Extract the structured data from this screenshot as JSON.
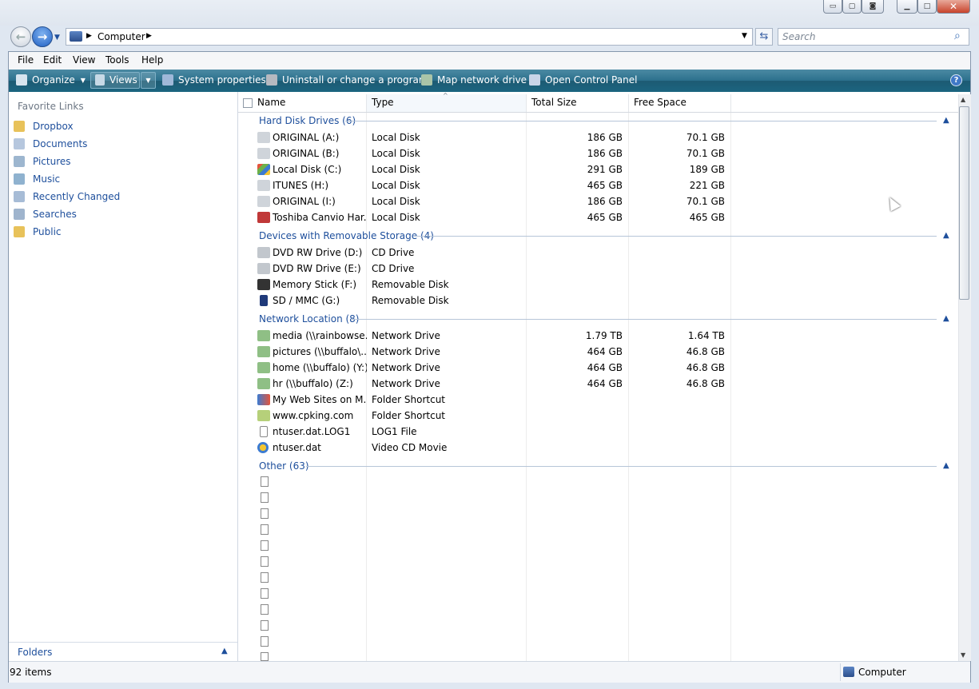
{
  "address": {
    "location": "Computer"
  },
  "search": {
    "placeholder": "Search"
  },
  "menu": {
    "items": [
      "File",
      "Edit",
      "View",
      "Tools",
      "Help"
    ]
  },
  "toolbar": {
    "organize": "Organize",
    "views": "Views",
    "system_properties": "System properties",
    "uninstall": "Uninstall or change a program",
    "map_drive": "Map network drive",
    "control_panel": "Open Control Panel"
  },
  "sidebar": {
    "header": "Favorite Links",
    "items": [
      {
        "label": "Dropbox",
        "icon": "folder-icon"
      },
      {
        "label": "Documents",
        "icon": "documents-icon"
      },
      {
        "label": "Pictures",
        "icon": "pictures-icon"
      },
      {
        "label": "Music",
        "icon": "music-icon"
      },
      {
        "label": "Recently Changed",
        "icon": "recent-icon"
      },
      {
        "label": "Searches",
        "icon": "search-folder-icon"
      },
      {
        "label": "Public",
        "icon": "folder-icon"
      }
    ],
    "folders_label": "Folders"
  },
  "columns": {
    "name": "Name",
    "type": "Type",
    "total": "Total Size",
    "free": "Free Space"
  },
  "groups": [
    {
      "title": "Hard Disk Drives (6)",
      "rows": [
        {
          "name": "ORIGINAL (A:)",
          "type": "Local Disk",
          "total": "186 GB",
          "free": "70.1 GB"
        },
        {
          "name": "ORIGINAL (B:)",
          "type": "Local Disk",
          "total": "186 GB",
          "free": "70.1 GB"
        },
        {
          "name": "Local Disk (C:)",
          "type": "Local Disk",
          "total": "291 GB",
          "free": "189 GB"
        },
        {
          "name": "ITUNES (H:)",
          "type": "Local Disk",
          "total": "465 GB",
          "free": "221 GB"
        },
        {
          "name": "ORIGINAL (I:)",
          "type": "Local Disk",
          "total": "186 GB",
          "free": "70.1 GB"
        },
        {
          "name": "Toshiba Canvio Har...",
          "type": "Local Disk",
          "total": "465 GB",
          "free": "465 GB"
        }
      ]
    },
    {
      "title": "Devices with Removable Storage (4)",
      "rows": [
        {
          "name": "DVD RW Drive (D:)",
          "type": "CD Drive",
          "total": "",
          "free": ""
        },
        {
          "name": "DVD RW Drive (E:)",
          "type": "CD Drive",
          "total": "",
          "free": ""
        },
        {
          "name": "Memory Stick (F:)",
          "type": "Removable Disk",
          "total": "",
          "free": ""
        },
        {
          "name": "SD / MMC (G:)",
          "type": "Removable Disk",
          "total": "",
          "free": ""
        }
      ]
    },
    {
      "title": "Network Location (8)",
      "rows": [
        {
          "name": "media (\\\\rainbowse...",
          "type": "Network Drive",
          "total": "1.79 TB",
          "free": "1.64 TB"
        },
        {
          "name": "pictures (\\\\buffalo\\...",
          "type": "Network Drive",
          "total": "464 GB",
          "free": "46.8 GB"
        },
        {
          "name": "home (\\\\buffalo) (Y:)",
          "type": "Network Drive",
          "total": "464 GB",
          "free": "46.8 GB"
        },
        {
          "name": "hr (\\\\buffalo) (Z:)",
          "type": "Network Drive",
          "total": "464 GB",
          "free": "46.8 GB"
        },
        {
          "name": "My Web Sites on M...",
          "type": "Folder Shortcut",
          "total": "",
          "free": ""
        },
        {
          "name": "www.cpking.com",
          "type": "Folder Shortcut",
          "total": "",
          "free": ""
        },
        {
          "name": "ntuser.dat.LOG1",
          "type": "LOG1 File",
          "total": "",
          "free": ""
        },
        {
          "name": "ntuser.dat",
          "type": "Video CD Movie",
          "total": "",
          "free": ""
        }
      ]
    },
    {
      "title": "Other (63)",
      "rows": []
    }
  ],
  "status": {
    "count": "92 items",
    "location": "Computer"
  },
  "colors": {
    "link": "#1e4f9c",
    "toolbar": "#2b6f8c"
  }
}
